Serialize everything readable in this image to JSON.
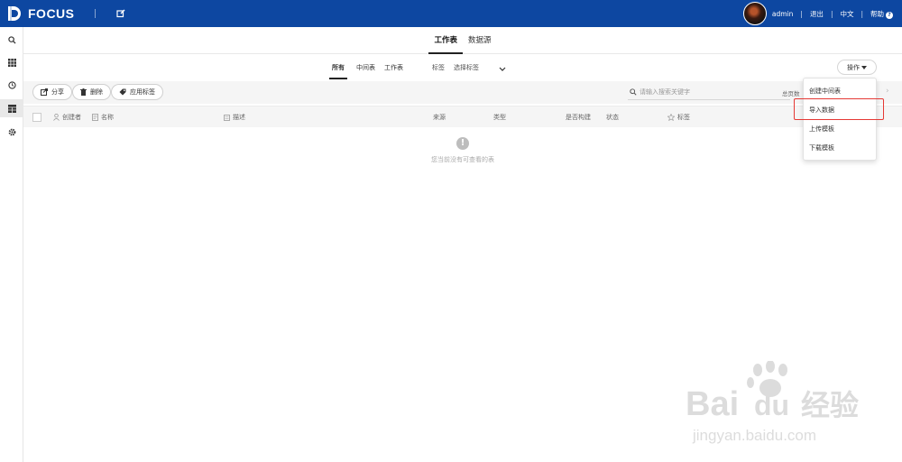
{
  "header": {
    "app_name": "FOCUS",
    "user": "admin",
    "logout": "退出",
    "language": "中文",
    "help": "帮助",
    "brand_color": "#0d47a1"
  },
  "sidebar": {
    "items": [
      {
        "icon": "search-icon"
      },
      {
        "icon": "grid-icon"
      },
      {
        "icon": "clock-icon"
      },
      {
        "icon": "table-icon",
        "active": true
      },
      {
        "icon": "gear-icon"
      }
    ]
  },
  "main_tabs": [
    {
      "label": "工作表",
      "active": true
    },
    {
      "label": "数据源",
      "active": false
    }
  ],
  "sub_tabs": {
    "all": "所有",
    "intermediate": "中间表",
    "worksheet": "工作表",
    "tag": "标签",
    "select_tag": "选择标签"
  },
  "operate_button": "操作",
  "toolbar": {
    "share": "分享",
    "delete": "删除",
    "apply_tag": "应用标签",
    "search_placeholder": "请输入搜索关键字",
    "total_label": "总页数"
  },
  "table": {
    "columns": {
      "creator": "创建者",
      "name": "名称",
      "description": "描述",
      "source": "来源",
      "type": "类型",
      "is_built": "是否构建",
      "status": "状态",
      "tag": "标签"
    },
    "empty_text": "您当前没有可查看的表"
  },
  "dropdown": {
    "items": [
      "创建中间表",
      "导入数据",
      "上传模板",
      "下载模板"
    ],
    "highlighted": "导入数据",
    "highlight_color": "#e53935"
  },
  "watermark": {
    "line1": "Bai",
    "line1b": "du",
    "line1c": "经验",
    "line2": "jingyan.baidu.com"
  }
}
